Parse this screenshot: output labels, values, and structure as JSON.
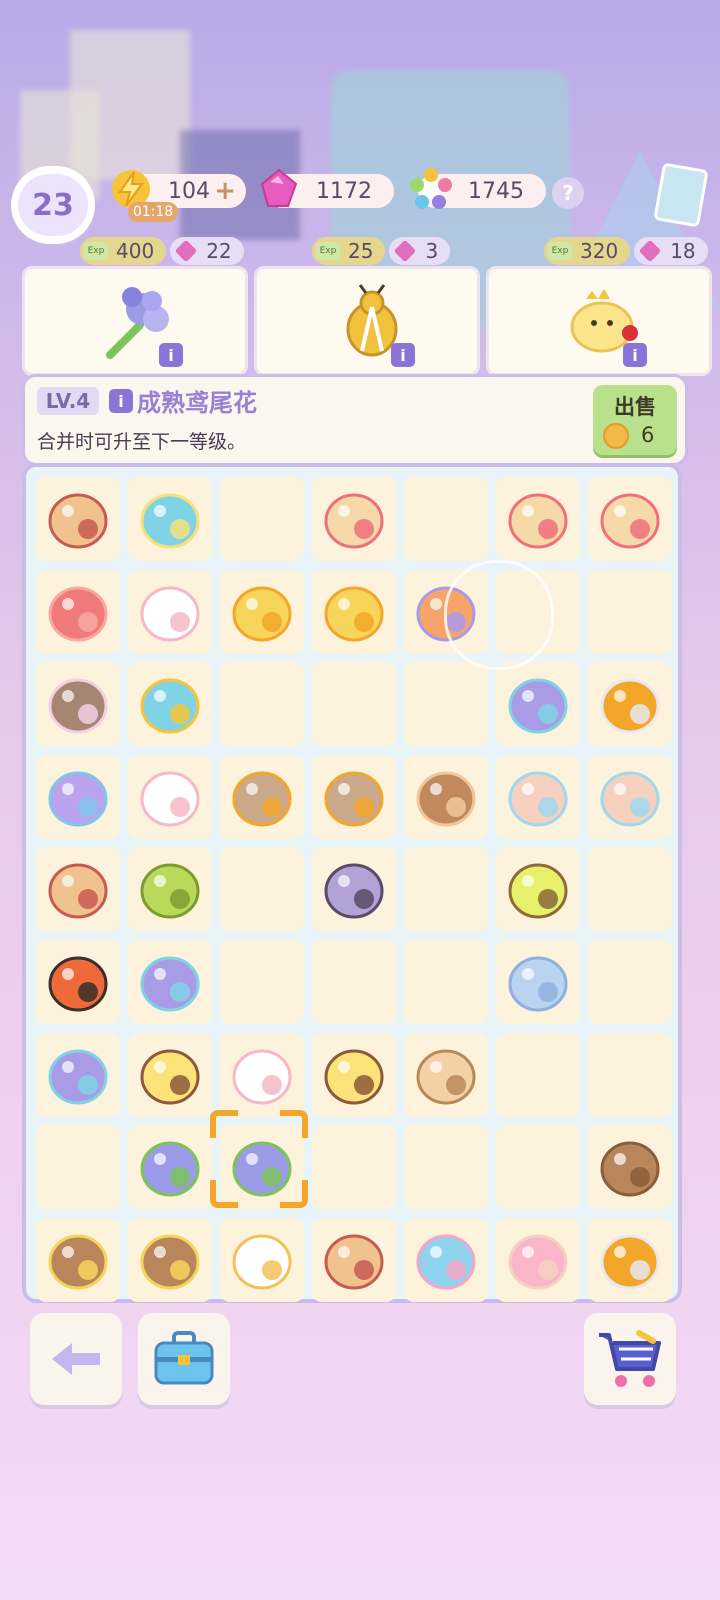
{
  "hud": {
    "level": "23",
    "energy": "104",
    "energy_plus": "+",
    "energy_timer": "01:18",
    "gems": "1172",
    "stars": "1745",
    "help": "?"
  },
  "orders": [
    {
      "exp": "400",
      "gems": "22",
      "exp_tag": "Exp",
      "item_icon": "iris-flower-icon"
    },
    {
      "exp": "25",
      "gems": "3",
      "exp_tag": "Exp",
      "item_icon": "ladybug-icon"
    },
    {
      "exp": "320",
      "gems": "18",
      "exp_tag": "Exp",
      "item_icon": "chick-king-icon"
    }
  ],
  "selected_item": {
    "level": "LV.4",
    "info": "i",
    "name": "成熟鸢尾花",
    "description": "合并时可升至下一等级。",
    "sell_label": "出售",
    "sell_price": "6"
  },
  "board": {
    "rows": [
      [
        "hamster-reading-icon",
        "snail-shell-icon",
        "",
        "fishing-rod-icon",
        "",
        "fishing-rod-icon",
        "fishing-rod-icon"
      ],
      [
        "coral-icon",
        "ghost-icon",
        "gift-box-icon",
        "gift-box-icon",
        "coral-bouquet-icon",
        "",
        ""
      ],
      [
        "mushroom-icon",
        "magnifier-icon",
        "",
        "",
        "",
        "butterfly-icon",
        "scissors-icon"
      ],
      [
        "tamagotchi-icon",
        "cloud-ghost-icon",
        "tabby-cat-icon",
        "tabby-cat-icon",
        "reel-icon",
        "hamster-icon",
        "hamster-icon"
      ],
      [
        "hamster-reading-icon",
        "firefly-pouch-icon",
        "",
        "notebook-icon",
        "",
        "firefly-jar-icon",
        ""
      ],
      [
        "ladybug-icon",
        "butterfly-icon",
        "",
        "",
        "",
        "cocoon-icon",
        ""
      ],
      [
        "butterfly-icon",
        "bee-icon",
        "ghost-icon",
        "bee-icon",
        "leaf-cocoon-icon",
        "",
        ""
      ],
      [
        "",
        "iris-flower-icon",
        "iris-flower-icon",
        "",
        "",
        "",
        "basket-icon"
      ],
      [
        "flower-basket-icon",
        "flower-basket-icon",
        "rice-cooker-icon",
        "hamster-reading-icon",
        "mixer-icon",
        "pink-hamster-icon",
        "scissors-icon"
      ]
    ]
  },
  "buttons": {
    "back": "back-arrow-icon",
    "toolbox": "toolbox-icon",
    "shop": "shopping-cart-icon"
  },
  "colors": {
    "accent": "#8b74d6",
    "cell": "#fdf3dc",
    "board_border": "#c8bde9",
    "sell_green": "#b9e08a"
  }
}
